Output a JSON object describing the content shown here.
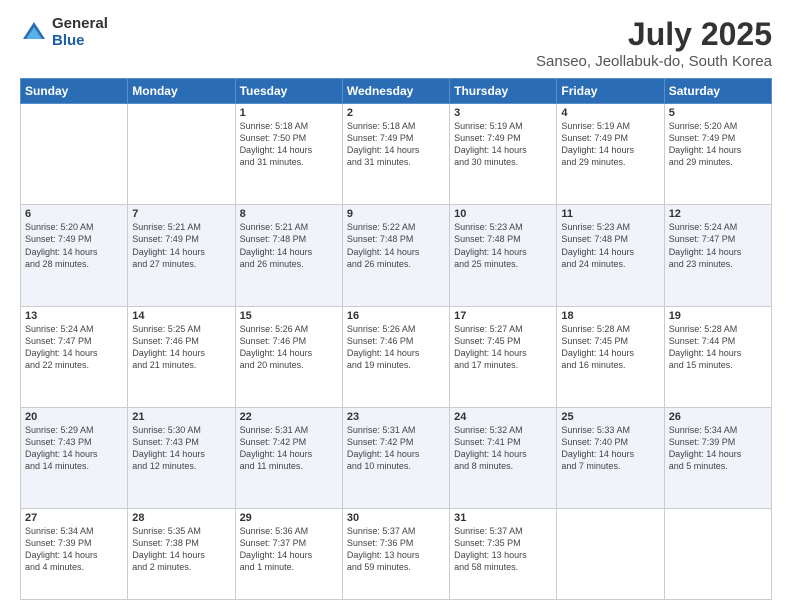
{
  "logo": {
    "general": "General",
    "blue": "Blue"
  },
  "header": {
    "title": "July 2025",
    "subtitle": "Sanseo, Jeollabuk-do, South Korea"
  },
  "days_of_week": [
    "Sunday",
    "Monday",
    "Tuesday",
    "Wednesday",
    "Thursday",
    "Friday",
    "Saturday"
  ],
  "weeks": [
    [
      {
        "day": "",
        "info": ""
      },
      {
        "day": "",
        "info": ""
      },
      {
        "day": "1",
        "info": "Sunrise: 5:18 AM\nSunset: 7:50 PM\nDaylight: 14 hours\nand 31 minutes."
      },
      {
        "day": "2",
        "info": "Sunrise: 5:18 AM\nSunset: 7:49 PM\nDaylight: 14 hours\nand 31 minutes."
      },
      {
        "day": "3",
        "info": "Sunrise: 5:19 AM\nSunset: 7:49 PM\nDaylight: 14 hours\nand 30 minutes."
      },
      {
        "day": "4",
        "info": "Sunrise: 5:19 AM\nSunset: 7:49 PM\nDaylight: 14 hours\nand 29 minutes."
      },
      {
        "day": "5",
        "info": "Sunrise: 5:20 AM\nSunset: 7:49 PM\nDaylight: 14 hours\nand 29 minutes."
      }
    ],
    [
      {
        "day": "6",
        "info": "Sunrise: 5:20 AM\nSunset: 7:49 PM\nDaylight: 14 hours\nand 28 minutes."
      },
      {
        "day": "7",
        "info": "Sunrise: 5:21 AM\nSunset: 7:49 PM\nDaylight: 14 hours\nand 27 minutes."
      },
      {
        "day": "8",
        "info": "Sunrise: 5:21 AM\nSunset: 7:48 PM\nDaylight: 14 hours\nand 26 minutes."
      },
      {
        "day": "9",
        "info": "Sunrise: 5:22 AM\nSunset: 7:48 PM\nDaylight: 14 hours\nand 26 minutes."
      },
      {
        "day": "10",
        "info": "Sunrise: 5:23 AM\nSunset: 7:48 PM\nDaylight: 14 hours\nand 25 minutes."
      },
      {
        "day": "11",
        "info": "Sunrise: 5:23 AM\nSunset: 7:48 PM\nDaylight: 14 hours\nand 24 minutes."
      },
      {
        "day": "12",
        "info": "Sunrise: 5:24 AM\nSunset: 7:47 PM\nDaylight: 14 hours\nand 23 minutes."
      }
    ],
    [
      {
        "day": "13",
        "info": "Sunrise: 5:24 AM\nSunset: 7:47 PM\nDaylight: 14 hours\nand 22 minutes."
      },
      {
        "day": "14",
        "info": "Sunrise: 5:25 AM\nSunset: 7:46 PM\nDaylight: 14 hours\nand 21 minutes."
      },
      {
        "day": "15",
        "info": "Sunrise: 5:26 AM\nSunset: 7:46 PM\nDaylight: 14 hours\nand 20 minutes."
      },
      {
        "day": "16",
        "info": "Sunrise: 5:26 AM\nSunset: 7:46 PM\nDaylight: 14 hours\nand 19 minutes."
      },
      {
        "day": "17",
        "info": "Sunrise: 5:27 AM\nSunset: 7:45 PM\nDaylight: 14 hours\nand 17 minutes."
      },
      {
        "day": "18",
        "info": "Sunrise: 5:28 AM\nSunset: 7:45 PM\nDaylight: 14 hours\nand 16 minutes."
      },
      {
        "day": "19",
        "info": "Sunrise: 5:28 AM\nSunset: 7:44 PM\nDaylight: 14 hours\nand 15 minutes."
      }
    ],
    [
      {
        "day": "20",
        "info": "Sunrise: 5:29 AM\nSunset: 7:43 PM\nDaylight: 14 hours\nand 14 minutes."
      },
      {
        "day": "21",
        "info": "Sunrise: 5:30 AM\nSunset: 7:43 PM\nDaylight: 14 hours\nand 12 minutes."
      },
      {
        "day": "22",
        "info": "Sunrise: 5:31 AM\nSunset: 7:42 PM\nDaylight: 14 hours\nand 11 minutes."
      },
      {
        "day": "23",
        "info": "Sunrise: 5:31 AM\nSunset: 7:42 PM\nDaylight: 14 hours\nand 10 minutes."
      },
      {
        "day": "24",
        "info": "Sunrise: 5:32 AM\nSunset: 7:41 PM\nDaylight: 14 hours\nand 8 minutes."
      },
      {
        "day": "25",
        "info": "Sunrise: 5:33 AM\nSunset: 7:40 PM\nDaylight: 14 hours\nand 7 minutes."
      },
      {
        "day": "26",
        "info": "Sunrise: 5:34 AM\nSunset: 7:39 PM\nDaylight: 14 hours\nand 5 minutes."
      }
    ],
    [
      {
        "day": "27",
        "info": "Sunrise: 5:34 AM\nSunset: 7:39 PM\nDaylight: 14 hours\nand 4 minutes."
      },
      {
        "day": "28",
        "info": "Sunrise: 5:35 AM\nSunset: 7:38 PM\nDaylight: 14 hours\nand 2 minutes."
      },
      {
        "day": "29",
        "info": "Sunrise: 5:36 AM\nSunset: 7:37 PM\nDaylight: 14 hours\nand 1 minute."
      },
      {
        "day": "30",
        "info": "Sunrise: 5:37 AM\nSunset: 7:36 PM\nDaylight: 13 hours\nand 59 minutes."
      },
      {
        "day": "31",
        "info": "Sunrise: 5:37 AM\nSunset: 7:35 PM\nDaylight: 13 hours\nand 58 minutes."
      },
      {
        "day": "",
        "info": ""
      },
      {
        "day": "",
        "info": ""
      }
    ]
  ]
}
